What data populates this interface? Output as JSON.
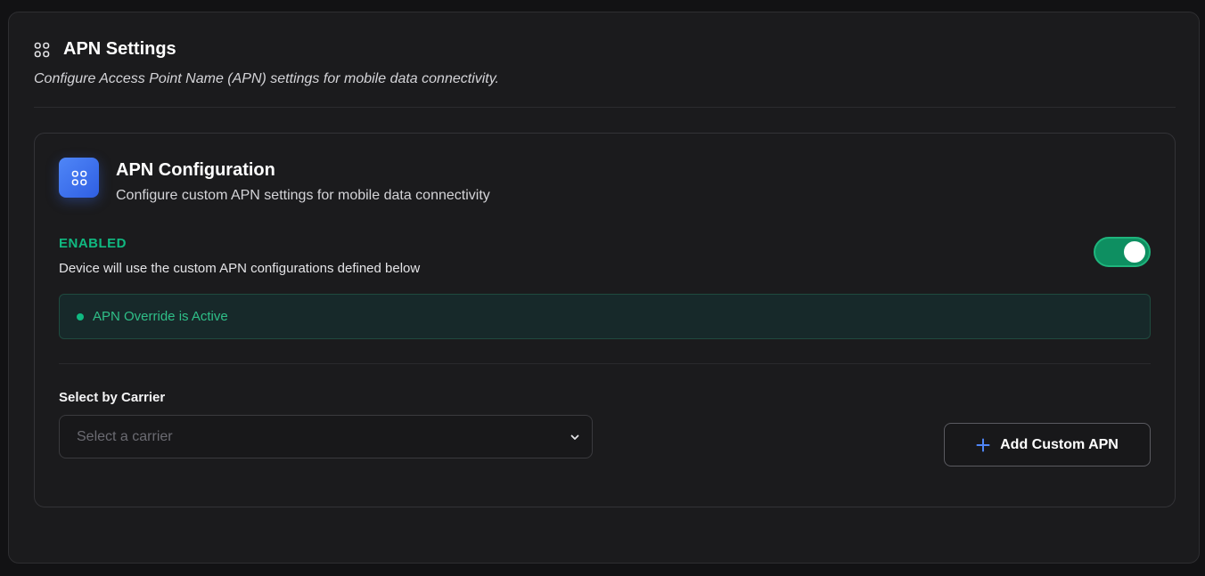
{
  "header": {
    "icon": "grid-icon",
    "title": "APN Settings",
    "description": "Configure Access Point Name (APN) settings for mobile data connectivity."
  },
  "card": {
    "icon": "grid-icon",
    "title": "APN Configuration",
    "subtitle": "Configure custom APN settings for mobile data connectivity",
    "accent_color": "#3b6ef0"
  },
  "status": {
    "label": "ENABLED",
    "description": "Device will use the custom APN configurations defined below",
    "toggle_on": true,
    "color": "#10b981"
  },
  "banner": {
    "text": "APN Override is Active"
  },
  "carrier_select": {
    "label": "Select by Carrier",
    "placeholder": "Select a carrier",
    "icon": "chevron-down-icon"
  },
  "add_button": {
    "label": "Add Custom APN",
    "icon": "plus-icon",
    "icon_color": "#4f86f7"
  }
}
